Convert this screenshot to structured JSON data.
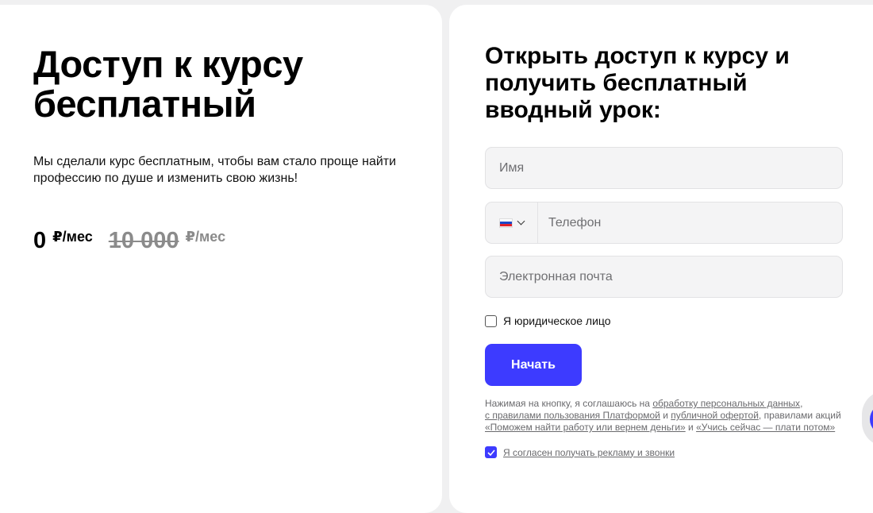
{
  "left": {
    "title": "Доступ к курсу бесплатный",
    "description": "Мы сделали курс бесплатным, чтобы вам стало проще найти профессию по душе и изменить свою жизнь!",
    "price_now": "0",
    "price_now_unit": "₽/мес",
    "price_old": "10 000",
    "price_old_unit": "₽/мес"
  },
  "form": {
    "title": "Открыть доступ к курсу и получить бесплатный вводный урок:",
    "name_placeholder": "Имя",
    "phone_placeholder": "Телефон",
    "email_placeholder": "Электронная почта",
    "country_flag_icon": "russia-flag-icon",
    "legal_entity_label": "Я юридическое лицо",
    "legal_entity_checked": false,
    "submit_label": "Начать",
    "legal_text_1": "Нажимая на кнопку, я соглашаюсь на ",
    "legal_link_1": "обработку персональных данных",
    "legal_text_2": ",",
    "legal_link_2": "с правилами пользования Платформой",
    "legal_text_3": " и ",
    "legal_link_3": "публичной офертой",
    "legal_text_4": ", правилами акций ",
    "legal_link_4": "«Поможем найти работу или вернем деньги»",
    "legal_text_5": " и ",
    "legal_link_5": "«Учись сейчас — плати потом»",
    "consent_label": "Я согласен получать рекламу и звонки",
    "consent_checked": true
  },
  "colors": {
    "accent": "#3d3bff",
    "background": "#f0f0f1",
    "card": "#ffffff"
  }
}
